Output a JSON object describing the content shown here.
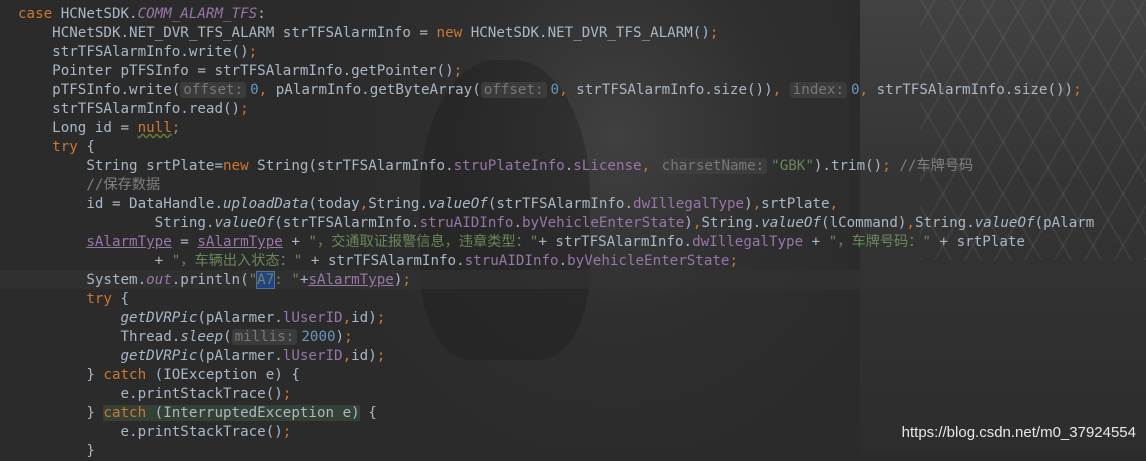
{
  "editor": {
    "theme": "darcula",
    "colors": {
      "background": "#2b2b2b",
      "keyword": "#cc7832",
      "field": "#9876aa",
      "method": "#ffc66d",
      "string": "#6a8759",
      "number": "#6897bb",
      "comment": "#808080"
    },
    "lines": [
      {
        "tokens": [
          {
            "t": "case ",
            "c": "kw"
          },
          {
            "t": "HCNetSDK."
          },
          {
            "t": "COMM_ALARM_TFS",
            "c": "fldi"
          },
          {
            "t": ":"
          }
        ]
      },
      {
        "tokens": [
          {
            "t": "    HCNetSDK.NET_DVR_TFS_ALARM strTFSAlarmInfo = "
          },
          {
            "t": "new ",
            "c": "kw"
          },
          {
            "t": "HCNetSDK.NET_DVR_TFS_ALARM()"
          },
          {
            "t": ";",
            "c": "kw"
          }
        ]
      },
      {
        "tokens": [
          {
            "t": "    strTFSAlarmInfo.write()"
          },
          {
            "t": ";",
            "c": "kw"
          }
        ]
      },
      {
        "tokens": [
          {
            "t": "    Pointer pTFSInfo = strTFSAlarmInfo.getPointer()"
          },
          {
            "t": ";",
            "c": "kw"
          }
        ]
      },
      {
        "tokens": [
          {
            "t": "    pTFSInfo.write("
          },
          {
            "t": "offset:",
            "c": "hint"
          },
          {
            "t": "0",
            "c": "num"
          },
          {
            "t": ", ",
            "c": "kw"
          },
          {
            "t": "pAlarmInfo.getByteArray("
          },
          {
            "t": "offset:",
            "c": "hint"
          },
          {
            "t": "0",
            "c": "num"
          },
          {
            "t": ", ",
            "c": "kw"
          },
          {
            "t": "strTFSAlarmInfo.size())"
          },
          {
            "t": ", ",
            "c": "kw"
          },
          {
            "t": "index:",
            "c": "hint"
          },
          {
            "t": "0",
            "c": "num"
          },
          {
            "t": ", ",
            "c": "kw"
          },
          {
            "t": "strTFSAlarmInfo.size())"
          },
          {
            "t": ";",
            "c": "kw"
          }
        ]
      },
      {
        "tokens": [
          {
            "t": "    strTFSAlarmInfo.read()"
          },
          {
            "t": ";",
            "c": "kw"
          }
        ]
      },
      {
        "tokens": [
          {
            "t": "    Long id = "
          },
          {
            "t": "null",
            "c": "kw warn"
          },
          {
            "t": ";",
            "c": "kw"
          }
        ]
      },
      {
        "tokens": [
          {
            "t": "    "
          },
          {
            "t": "try ",
            "c": "kw"
          },
          {
            "t": "{"
          }
        ]
      },
      {
        "tokens": [
          {
            "t": "        String srtPlate="
          },
          {
            "t": "new ",
            "c": "kw"
          },
          {
            "t": "String(strTFSAlarmInfo."
          },
          {
            "t": "struPlateInfo",
            "c": "fld"
          },
          {
            "t": "."
          },
          {
            "t": "sLicense",
            "c": "fld"
          },
          {
            "t": ", ",
            "c": "kw"
          },
          {
            "t": "charsetName:",
            "c": "hint"
          },
          {
            "t": "\"GBK\"",
            "c": "str"
          },
          {
            "t": ").trim()"
          },
          {
            "t": "; ",
            "c": "kw"
          },
          {
            "t": "//车牌号码",
            "c": "cmt"
          }
        ]
      },
      {
        "tokens": [
          {
            "t": "        "
          },
          {
            "t": "//保存数据",
            "c": "cmt"
          }
        ]
      },
      {
        "tokens": [
          {
            "t": "        id = DataHandle."
          },
          {
            "t": "uploadData",
            "c": "sfn"
          },
          {
            "t": "(today"
          },
          {
            "t": ",",
            "c": "kw"
          },
          {
            "t": "String."
          },
          {
            "t": "valueOf",
            "c": "sfn"
          },
          {
            "t": "(strTFSAlarmInfo."
          },
          {
            "t": "dwIllegalType",
            "c": "fld"
          },
          {
            "t": ")"
          },
          {
            "t": ",",
            "c": "kw"
          },
          {
            "t": "srtPlate"
          },
          {
            "t": ",",
            "c": "kw"
          }
        ]
      },
      {
        "tokens": [
          {
            "t": "                String."
          },
          {
            "t": "valueOf",
            "c": "sfn"
          },
          {
            "t": "(strTFSAlarmInfo."
          },
          {
            "t": "struAIDInfo",
            "c": "fld"
          },
          {
            "t": "."
          },
          {
            "t": "byVehicleEnterState",
            "c": "fld"
          },
          {
            "t": ")"
          },
          {
            "t": ",",
            "c": "kw"
          },
          {
            "t": "String."
          },
          {
            "t": "valueOf",
            "c": "sfn"
          },
          {
            "t": "(lCommand)"
          },
          {
            "t": ",",
            "c": "kw"
          },
          {
            "t": "String."
          },
          {
            "t": "valueOf",
            "c": "sfn"
          },
          {
            "t": "(pAlarm"
          }
        ]
      },
      {
        "tokens": [
          {
            "t": "        "
          },
          {
            "t": "sAlarmType",
            "c": "var"
          },
          {
            "t": " = "
          },
          {
            "t": "sAlarmType",
            "c": "var"
          },
          {
            "t": " + "
          },
          {
            "t": "\"，交通取证报警信息，违章类型：\"",
            "c": "str"
          },
          {
            "t": "+ strTFSAlarmInfo."
          },
          {
            "t": "dwIllegalType",
            "c": "fld"
          },
          {
            "t": " + "
          },
          {
            "t": "\"，车牌号码：\"",
            "c": "str"
          },
          {
            "t": " + srtPlate"
          }
        ]
      },
      {
        "tokens": [
          {
            "t": "                + "
          },
          {
            "t": "\"，车辆出入状态：\"",
            "c": "str"
          },
          {
            "t": " + strTFSAlarmInfo."
          },
          {
            "t": "struAIDInfo",
            "c": "fld"
          },
          {
            "t": "."
          },
          {
            "t": "byVehicleEnterState",
            "c": "fld"
          },
          {
            "t": ";",
            "c": "kw"
          }
        ]
      },
      {
        "tokens": [
          {
            "t": "        System."
          },
          {
            "t": "out",
            "c": "fldi"
          },
          {
            "t": ".println("
          },
          {
            "t": "\"",
            "c": "str"
          },
          {
            "t": "A7",
            "c": "str sel"
          },
          {
            "t": ": \"",
            "c": "str"
          },
          {
            "t": "+"
          },
          {
            "t": "sAlarmType",
            "c": "var"
          },
          {
            "t": ")"
          },
          {
            "t": ";",
            "c": "kw"
          }
        ]
      },
      {
        "tokens": [
          {
            "t": "        "
          },
          {
            "t": "try ",
            "c": "kw"
          },
          {
            "t": "{"
          }
        ]
      },
      {
        "tokens": [
          {
            "t": "            "
          },
          {
            "t": "getDVRPic",
            "c": "sfn"
          },
          {
            "t": "(pAlarmer."
          },
          {
            "t": "lUserID",
            "c": "fld"
          },
          {
            "t": ",",
            "c": "kw"
          },
          {
            "t": "id)"
          },
          {
            "t": ";",
            "c": "kw"
          }
        ]
      },
      {
        "tokens": [
          {
            "t": "            Thread."
          },
          {
            "t": "sleep",
            "c": "sfn"
          },
          {
            "t": "("
          },
          {
            "t": "millis:",
            "c": "hint"
          },
          {
            "t": "2000",
            "c": "num"
          },
          {
            "t": ")"
          },
          {
            "t": ";",
            "c": "kw"
          }
        ]
      },
      {
        "tokens": [
          {
            "t": "            "
          },
          {
            "t": "getDVRPic",
            "c": "sfn"
          },
          {
            "t": "(pAlarmer."
          },
          {
            "t": "lUserID",
            "c": "fld"
          },
          {
            "t": ",",
            "c": "kw"
          },
          {
            "t": "id)"
          },
          {
            "t": ";",
            "c": "kw"
          }
        ]
      },
      {
        "tokens": [
          {
            "t": "        } "
          },
          {
            "t": "catch ",
            "c": "kw"
          },
          {
            "t": "(IOException e) {"
          }
        ]
      },
      {
        "tokens": [
          {
            "t": "            e.printStackTrace()"
          },
          {
            "t": ";",
            "c": "kw"
          }
        ]
      },
      {
        "tokens": [
          {
            "t": "        } "
          },
          {
            "t": "catch ",
            "c": "kw exc-hl"
          },
          {
            "t": "(InterruptedException e)",
            "c": "exc-hl"
          },
          {
            "t": " {"
          }
        ]
      },
      {
        "tokens": [
          {
            "t": "            e.printStackTrace()"
          },
          {
            "t": ";",
            "c": "kw"
          }
        ]
      },
      {
        "tokens": [
          {
            "t": "        }"
          }
        ]
      }
    ]
  },
  "watermark": "https://blog.csdn.net/m0_37924554"
}
